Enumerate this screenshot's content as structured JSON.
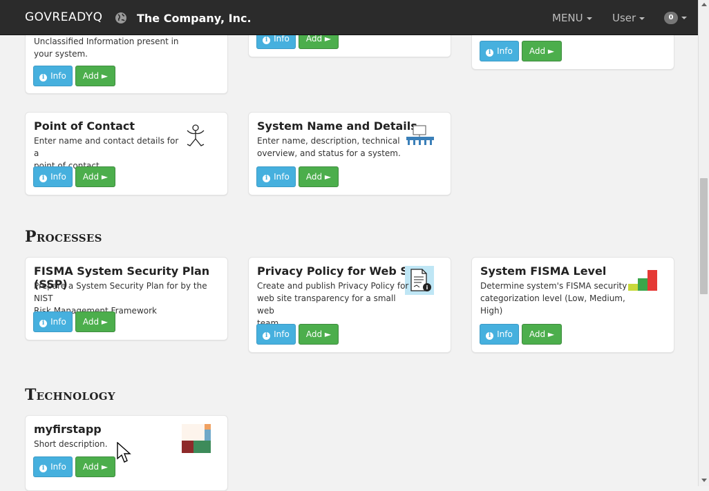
{
  "header": {
    "brand": "GOVREADYQ",
    "org_name": "The Company, Inc.",
    "menu_label": "MENU",
    "user_label": "User",
    "notification_count": "0"
  },
  "buttons": {
    "info": "Info",
    "add": "Add ►"
  },
  "top_cards": [
    {
      "desc_lines": [
        "Unclassified Information present in",
        "your system."
      ]
    }
  ],
  "apps_row2": [
    {
      "title": "Point of Contact",
      "desc_lines": [
        "Enter name and contact details for a",
        "point of contact."
      ],
      "icon": "stick-figure-icon"
    },
    {
      "title": "System Name and Details",
      "desc_lines": [
        "Enter name, description, technical",
        "overview, and status for a system."
      ],
      "icon": "presentation-icon"
    }
  ],
  "sections": {
    "processes": "Processes",
    "technology": "Technology"
  },
  "processes": [
    {
      "title": "FISMA System Security Plan (SSP)",
      "desc_lines": [
        "Prepare a System Security Plan for by the NIST",
        "Risk Management Framework"
      ]
    },
    {
      "title": "Privacy Policy for Web Site",
      "desc_lines": [
        "Create and publish Privacy Policy for",
        "web site transparency for a small web",
        "team"
      ],
      "icon": "document-icon"
    },
    {
      "title": "System FISMA Level",
      "desc_lines": [
        "Determine system's FISMA security",
        "categorization level (Low, Medium,",
        "High)"
      ],
      "icon": "level-bars-icon"
    }
  ],
  "technology": [
    {
      "title": "myfirstapp",
      "desc_lines": [
        "Short description."
      ],
      "icon": "app-tile-icon"
    }
  ],
  "colors": {
    "info": "#46b0de",
    "add": "#4cae4c",
    "navbar": "#2b2b2b"
  }
}
